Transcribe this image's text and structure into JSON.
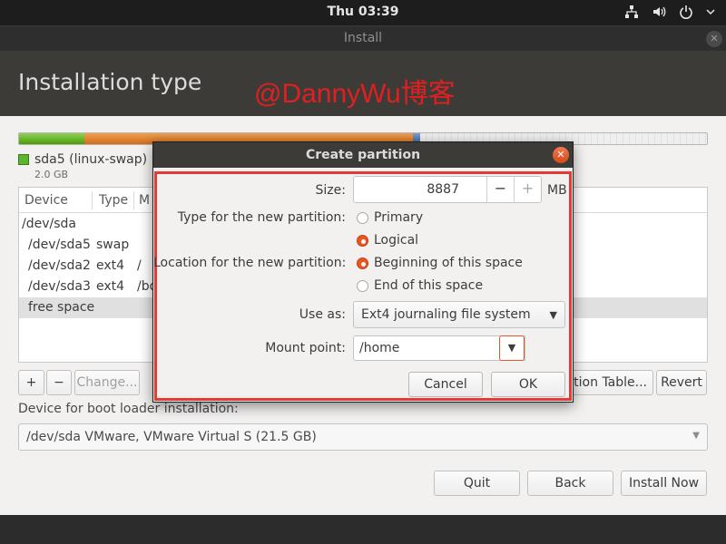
{
  "topbar": {
    "clock": "Thu 03:39",
    "tray_icons": [
      "network-icon",
      "volume-icon",
      "power-icon",
      "chevron-down-icon"
    ]
  },
  "window": {
    "title": "Install",
    "close_icon": "close-icon"
  },
  "header": {
    "title": "Installation type",
    "watermark": "@DannyWu博客"
  },
  "partition_bar": {
    "legend_name": "sda5 (linux-swap)",
    "legend_size": "2.0 GB",
    "colors": {
      "swap": "#5fb332",
      "ext4": "#e07b2c",
      "other": "#3d5f9a",
      "free": "#ececec"
    }
  },
  "table": {
    "columns": [
      "Device",
      "Type",
      "M"
    ],
    "rows": [
      {
        "device": "/dev/sda",
        "type": "",
        "mount": ""
      },
      {
        "device": "/dev/sda5",
        "type": "swap",
        "mount": ""
      },
      {
        "device": "/dev/sda2",
        "type": "ext4",
        "mount": "/"
      },
      {
        "device": "/dev/sda3",
        "type": "ext4",
        "mount": "/bo"
      },
      {
        "device": "free space",
        "type": "",
        "mount": ""
      }
    ]
  },
  "table_buttons": {
    "add": "+",
    "remove": "−",
    "change": "Change...",
    "new_table": "ition Table...",
    "revert": "Revert"
  },
  "bootloader": {
    "label": "Device for boot loader installation:",
    "value": "/dev/sda   VMware, VMware Virtual S (21.5 GB)"
  },
  "actions": {
    "quit": "Quit",
    "back": "Back",
    "install_now": "Install Now"
  },
  "dialog": {
    "title": "Create partition",
    "size_label": "Size:",
    "size_value": "8887",
    "size_unit": "MB",
    "minus": "−",
    "plus": "+",
    "type_label": "Type for the new partition:",
    "type_options": [
      "Primary",
      "Logical"
    ],
    "type_selected": "Logical",
    "location_label": "Location for the new partition:",
    "location_options": [
      "Beginning of this space",
      "End of this space"
    ],
    "location_selected": "Beginning of this space",
    "use_as_label": "Use as:",
    "use_as_value": "Ext4 journaling file system",
    "mount_label": "Mount point:",
    "mount_value": "/home",
    "cancel": "Cancel",
    "ok": "OK",
    "accent_color": "#e95420",
    "highlight_color": "#e53935"
  }
}
